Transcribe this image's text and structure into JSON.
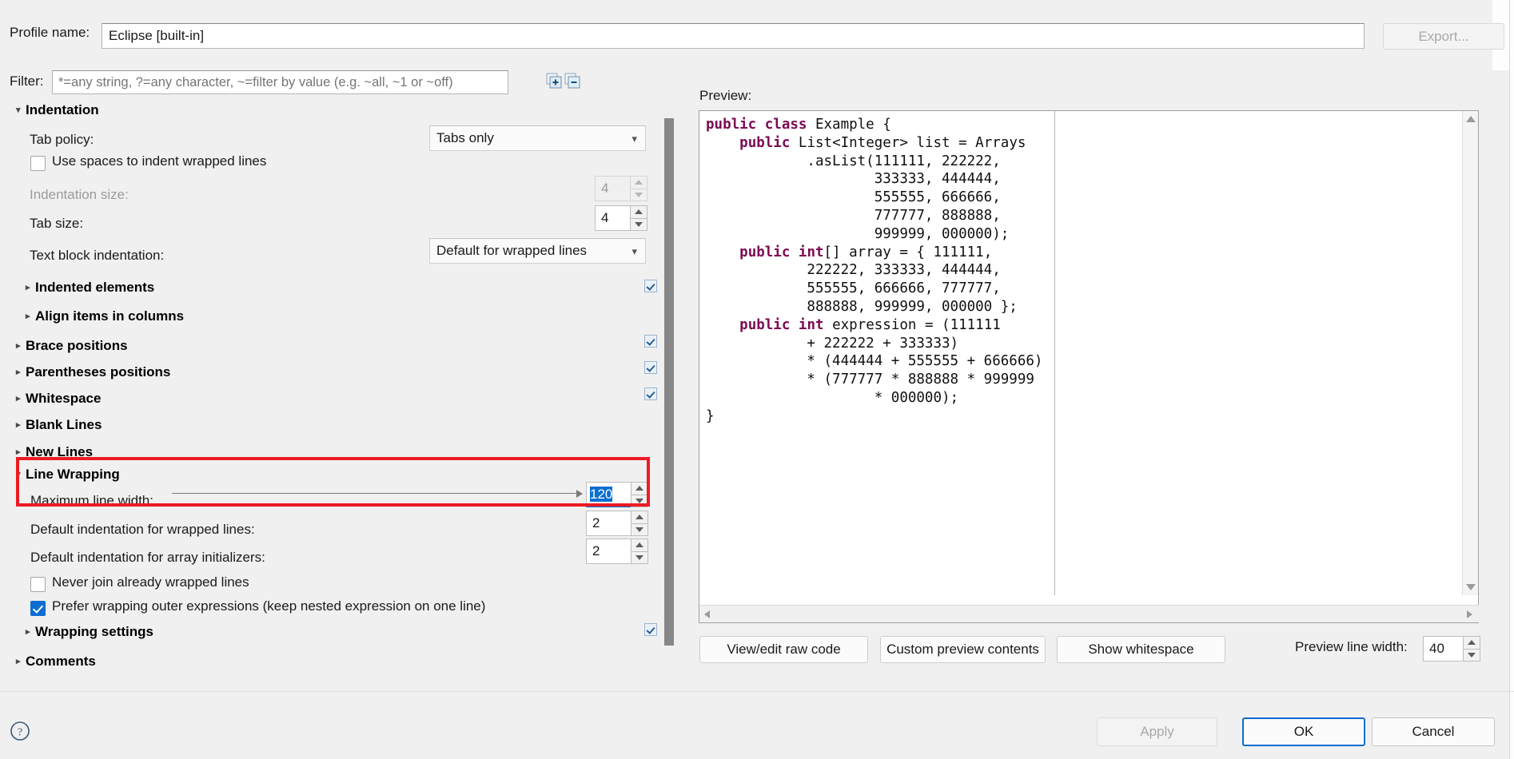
{
  "dialog": {
    "profile_label": "Profile name:",
    "profile_value": "Eclipse [built-in]",
    "export_button": "Export...",
    "filter_label": "Filter:",
    "filter_placeholder": "*=any string, ?=any character, ~=filter by value (e.g. ~all, ~1 or ~off)",
    "filter_value": "",
    "expand_all_icon": "expand-all-icon",
    "collapse_all_icon": "collapse-all-icon",
    "help_icon": "help-icon"
  },
  "settings": {
    "indentation": {
      "header": "Indentation",
      "expanded": true,
      "tab_policy_label": "Tab policy:",
      "tab_policy_value": "Tabs only",
      "use_spaces_label": "Use spaces to indent wrapped lines",
      "use_spaces_checked": false,
      "indentation_size_label": "Indentation size:",
      "indentation_size_value": "4",
      "indentation_size_enabled": false,
      "tab_size_label": "Tab size:",
      "tab_size_value": "4",
      "text_block_label": "Text block indentation:",
      "text_block_value": "Default for wrapped lines",
      "subgroups": [
        {
          "label": "Indented elements",
          "has_checkbox": true
        },
        {
          "label": "Align items in columns",
          "has_checkbox": false
        }
      ]
    },
    "groups": [
      {
        "label": "Brace positions",
        "has_checkbox": true
      },
      {
        "label": "Parentheses positions",
        "has_checkbox": true
      },
      {
        "label": "Whitespace",
        "has_checkbox": true
      },
      {
        "label": "Blank Lines",
        "has_checkbox": false
      },
      {
        "label": "New Lines",
        "has_checkbox": false
      }
    ],
    "line_wrapping": {
      "header": "Line Wrapping",
      "expanded": true,
      "highlighted": true,
      "highlight_color": "#ec1b24",
      "max_line_width_label": "Maximum line width:",
      "max_line_width_value": "120",
      "max_line_width_selected": true,
      "default_indent_wrapped_label": "Default indentation for wrapped lines:",
      "default_indent_wrapped_value": "2",
      "default_indent_array_label": "Default indentation for array initializers:",
      "default_indent_array_value": "2",
      "never_join_label": "Never join already wrapped lines",
      "never_join_checked": false,
      "prefer_wrapping_label": "Prefer wrapping outer expressions (keep nested expression on one line)",
      "prefer_wrapping_checked": true,
      "wrapping_settings_label": "Wrapping settings"
    },
    "comments": {
      "label": "Comments"
    }
  },
  "preview": {
    "label": "Preview:",
    "code_lines": [
      [
        {
          "t": "public class ",
          "k": true
        },
        {
          "t": "Example {",
          "k": false
        }
      ],
      [
        {
          "t": "    ",
          "k": false
        },
        {
          "t": "public ",
          "k": true
        },
        {
          "t": "List<Integer> list = Arrays",
          "k": false
        }
      ],
      [
        {
          "t": "            .asList(111111, 222222,",
          "k": false
        }
      ],
      [
        {
          "t": "                    333333, 444444,",
          "k": false
        }
      ],
      [
        {
          "t": "                    555555, 666666,",
          "k": false
        }
      ],
      [
        {
          "t": "                    777777, 888888,",
          "k": false
        }
      ],
      [
        {
          "t": "                    999999, 000000);",
          "k": false
        }
      ],
      [
        {
          "t": "    ",
          "k": false
        },
        {
          "t": "public int",
          "k": true
        },
        {
          "t": "[] array = { 111111,",
          "k": false
        }
      ],
      [
        {
          "t": "            222222, 333333, 444444,",
          "k": false
        }
      ],
      [
        {
          "t": "            555555, 666666, 777777,",
          "k": false
        }
      ],
      [
        {
          "t": "            888888, 999999, 000000 };",
          "k": false
        }
      ],
      [
        {
          "t": "    ",
          "k": false
        },
        {
          "t": "public int ",
          "k": true
        },
        {
          "t": "expression = (111111",
          "k": false
        }
      ],
      [
        {
          "t": "            + 222222 + 333333)",
          "k": false
        }
      ],
      [
        {
          "t": "            * (444444 + 555555 + 666666)",
          "k": false
        }
      ],
      [
        {
          "t": "            * (777777 * 888888 * 999999",
          "k": false
        }
      ],
      [
        {
          "t": "                    * 000000);",
          "k": false
        }
      ],
      [
        {
          "t": "}",
          "k": false
        }
      ]
    ],
    "keyword_color": "#7c0a53",
    "buttons": [
      {
        "label": "View/edit raw code"
      },
      {
        "label": "Custom preview contents"
      },
      {
        "label": "Show whitespace"
      }
    ],
    "preview_line_width_label": "Preview line width:",
    "preview_line_width_value": "40"
  },
  "footer": {
    "apply_label": "Apply",
    "apply_enabled": false,
    "ok_label": "OK",
    "ok_focused": true,
    "cancel_label": "Cancel"
  }
}
